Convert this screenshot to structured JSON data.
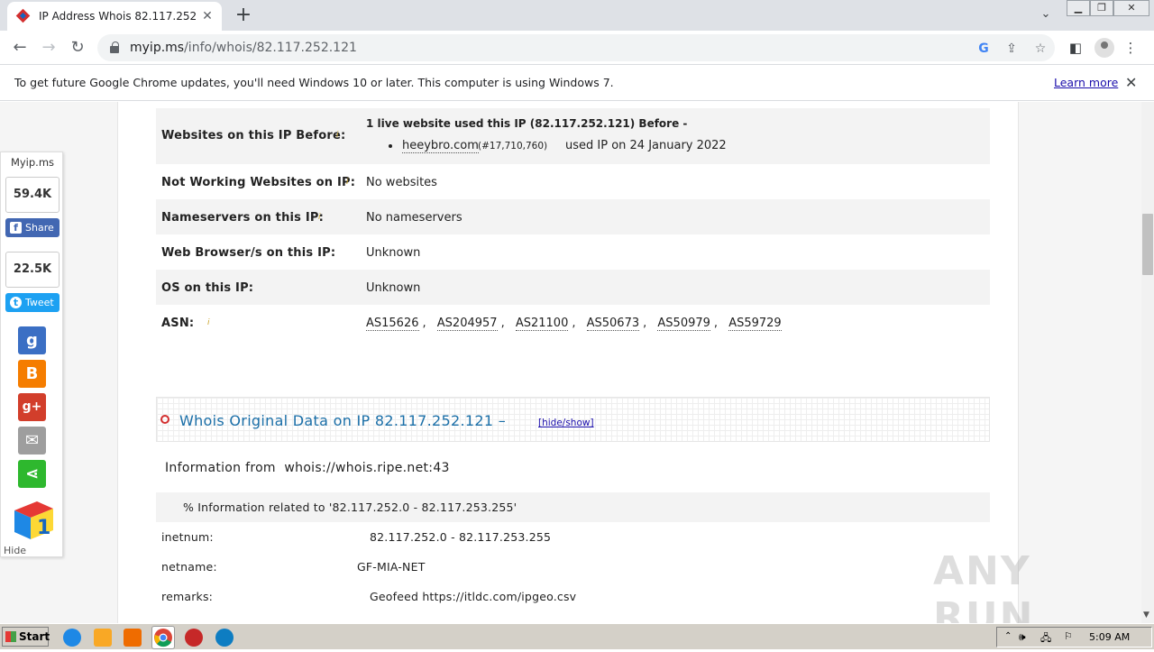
{
  "browser": {
    "tab_title": "IP Address Whois 82.117.252.121 ?",
    "tab_close": "✕",
    "new_tab": "+",
    "url_host": "myip.ms",
    "url_path": "/info/whois/82.117.252.121",
    "infobar_text": "To get future Google Chrome updates, you'll need Windows 10 or later. This computer is using Windows 7.",
    "infobar_link": "Learn more"
  },
  "sharebar": {
    "brand": "Myip.ms",
    "fb_count": "59.4K",
    "fb_label": "Share",
    "tw_count": "22.5K",
    "tw_label": "Tweet",
    "hide_label": "Hide"
  },
  "ip_info": {
    "websites_before_label": "Websites on this IP Before:",
    "websites_before_summary": "1 live website used this IP (82.117.252.121) Before -",
    "website_link": "heeybro.com",
    "website_rank": "(#17,710,760)",
    "website_used": "used IP on 24 January 2022",
    "not_working_label": "Not Working Websites on IP:",
    "not_working_value": "No websites",
    "nameservers_label": "Nameservers on this IP:",
    "nameservers_value": "No nameservers",
    "browsers_label": "Web Browser/s on this IP:",
    "browsers_value": "Unknown",
    "os_label": "OS on this IP:",
    "os_value": "Unknown",
    "asn_label": "ASN:",
    "asn_list": [
      "AS15626",
      "AS204957",
      "AS21100",
      "AS50673",
      "AS50979",
      "AS59729"
    ],
    "info_icon": "i"
  },
  "whois": {
    "title": "Whois Original Data on IP 82.117.252.121 –",
    "hide_show": "[hide/show]",
    "info_from_label": "Information from",
    "info_from_server": "whois://whois.ripe.net:43",
    "related": "% Information related to '82.117.252.0 - 82.117.253.255'",
    "rows": [
      {
        "key": "inetnum:",
        "value": "82.117.252.0 - 82.117.253.255"
      },
      {
        "key": "netname:",
        "value": "GF-MIA-NET"
      },
      {
        "key": "remarks:",
        "value": "Geofeed https://itldc.com/ipgeo.csv"
      }
    ]
  },
  "watermark": "ANY RUN",
  "taskbar": {
    "start_label": "Start",
    "clock": "5:09 AM"
  },
  "colors": {
    "whois_title": "#1b6fa8",
    "facebook": "#4267b2",
    "twitter": "#1da1f2"
  }
}
